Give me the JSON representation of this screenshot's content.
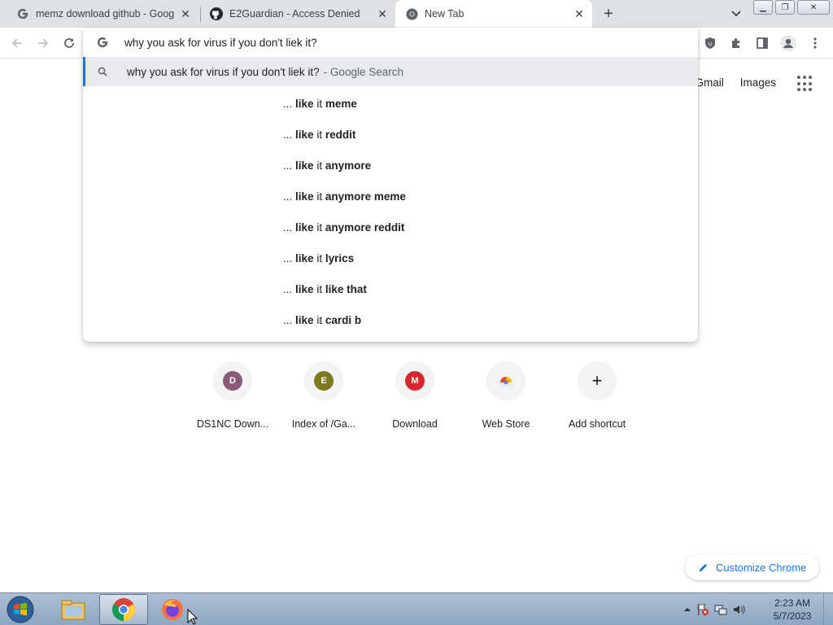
{
  "tabs": [
    {
      "title": "memz download github - Google",
      "favicon": "google-icon"
    },
    {
      "title": "E2Guardian - Access Denied",
      "favicon": "github-icon"
    },
    {
      "title": "New Tab",
      "favicon": "chrome-icon"
    }
  ],
  "omnibox": {
    "value": "why you ask for virus if you don't liek it?",
    "selected_suggestion": {
      "query": "why you ask for virus if you don't liek it?",
      "suffix": "- Google Search"
    },
    "suggestions": [
      {
        "prefix": "...",
        "bold1": "like",
        "plain": "it",
        "bold2": "meme"
      },
      {
        "prefix": "...",
        "bold1": "like",
        "plain": "it",
        "bold2": "reddit"
      },
      {
        "prefix": "...",
        "bold1": "like",
        "plain": "it",
        "bold2": "anymore"
      },
      {
        "prefix": "...",
        "bold1": "like",
        "plain": "it",
        "bold2": "anymore meme"
      },
      {
        "prefix": "...",
        "bold1": "like",
        "plain": "it",
        "bold2": "anymore reddit"
      },
      {
        "prefix": "...",
        "bold1": "like",
        "plain": "it",
        "bold2": "lyrics"
      },
      {
        "prefix": "...",
        "bold1": "like",
        "plain": "it",
        "bold2": "like that"
      },
      {
        "prefix": "...",
        "bold1": "like",
        "plain": "it",
        "bold2": "cardi b"
      }
    ]
  },
  "header_links": {
    "gmail": "Gmail",
    "images": "Images"
  },
  "shortcuts": [
    {
      "label": "DS1NC Down...",
      "letter": "D",
      "color": "#8a5a78"
    },
    {
      "label": "Index of /Ga...",
      "letter": "E",
      "color": "#7d7a1e"
    },
    {
      "label": "Download",
      "letter": "M",
      "color": "#d9272e"
    },
    {
      "label": "Web Store",
      "letter": "",
      "color": ""
    },
    {
      "label": "Add shortcut",
      "letter": "+",
      "color": ""
    }
  ],
  "customize_label": "Customize Chrome",
  "clock": {
    "time": "2:23 AM",
    "date": "5/7/2023"
  },
  "colors": {
    "accent": "#1a73e8",
    "tabstrip": "#dee1e6"
  }
}
